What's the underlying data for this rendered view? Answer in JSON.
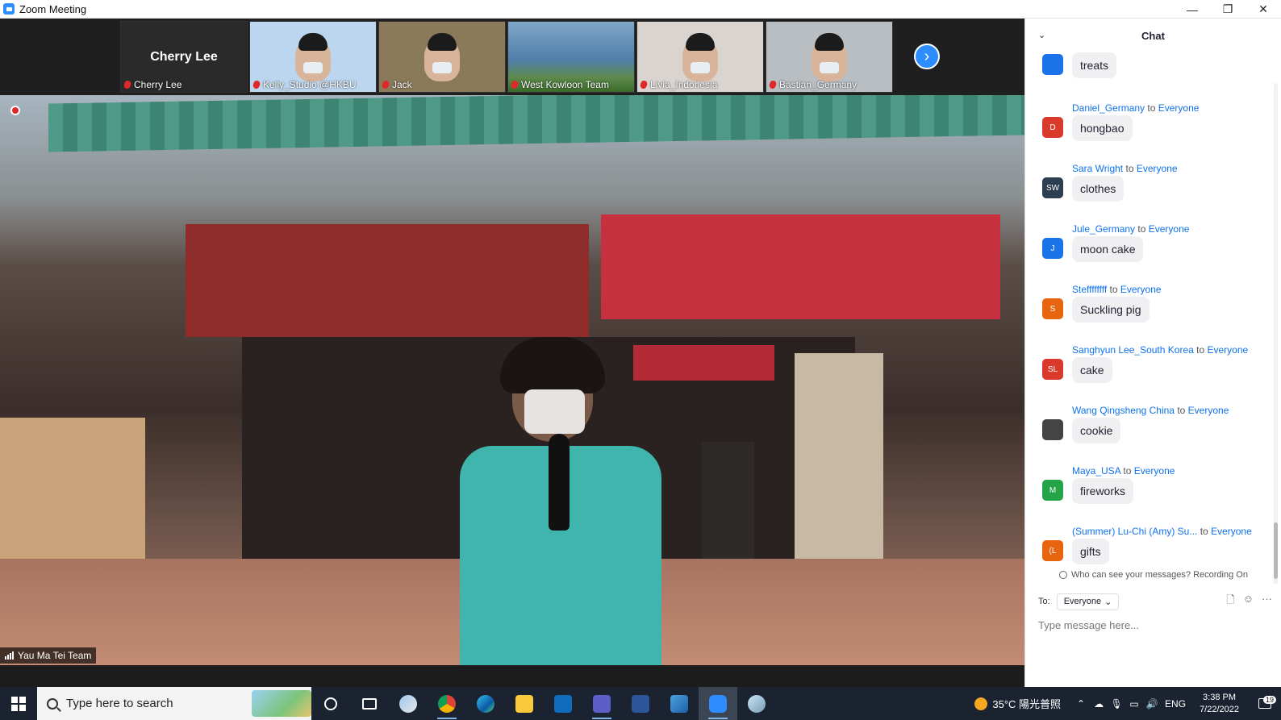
{
  "window": {
    "title": "Zoom Meeting",
    "minimize": "—",
    "restore": "❐",
    "close": "✕"
  },
  "thumbnails": [
    {
      "name": "Cherry Lee",
      "display_name": "Cherry Lee",
      "video": false,
      "bg": "#222222"
    },
    {
      "name": "Kelly_Studio @HKBU",
      "video": true,
      "bg": "#bcd6ef"
    },
    {
      "name": "Jack",
      "video": true,
      "bg": "#8a7a5a"
    },
    {
      "name": "West Kowloon Team",
      "video": true,
      "bg": "#4f7ea8"
    },
    {
      "name": "Livia_Indonesia",
      "video": true,
      "bg": "#d9d4cf"
    },
    {
      "name": "Bastian_Germany",
      "video": true,
      "bg": "#b9bec3"
    }
  ],
  "main_video": {
    "speaker": "Yau Ma Tei Team"
  },
  "chat": {
    "title": "Chat",
    "partial_top_message": "treats",
    "connector": "to",
    "messages": [
      {
        "sender": "Daniel_Germany",
        "recipient": "Everyone",
        "text": "hongbao",
        "initials": "D",
        "color": "#d93a2b"
      },
      {
        "sender": "Sara Wright",
        "recipient": "Everyone",
        "text": "clothes",
        "initials": "SW",
        "color": "#2c3e50"
      },
      {
        "sender": "Jule_Germany",
        "recipient": "Everyone",
        "text": "moon cake",
        "initials": "J",
        "color": "#1a73e8"
      },
      {
        "sender": "Steffffffff",
        "recipient": "Everyone",
        "text": "Suckling pig",
        "initials": "S",
        "color": "#e8650f"
      },
      {
        "sender": "Sanghyun Lee_South Korea",
        "recipient": "Everyone",
        "text": "cake",
        "initials": "SL",
        "color": "#d93a2b"
      },
      {
        "sender": "Wang Qingsheng China",
        "recipient": "Everyone",
        "text": "cookie",
        "initials": "",
        "color": "#444444"
      },
      {
        "sender": "Maya_USA",
        "recipient": "Everyone",
        "text": "fireworks",
        "initials": "M",
        "color": "#22a447"
      },
      {
        "sender": "(Summer) Lu-Chi (Amy) Su...",
        "recipient": "Everyone",
        "text": "gifts",
        "initials": "(L",
        "color": "#e8650f"
      }
    ],
    "visibility_notice": "Who can see your messages? Recording On",
    "to_label": "To:",
    "to_value": "Everyone",
    "input_placeholder": "Type message here..."
  },
  "taskbar": {
    "search_placeholder": "Type here to search",
    "weather": "35°C 陽光普照",
    "language": "ENG",
    "time": "3:38 PM",
    "date": "7/22/2022",
    "notifications": "19"
  }
}
